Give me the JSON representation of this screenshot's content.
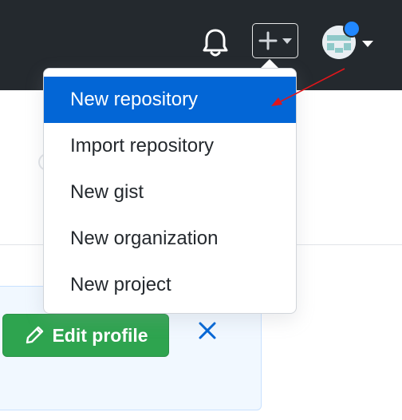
{
  "header": {
    "background": "#24292e",
    "icons": [
      "bell-icon",
      "plus-icon",
      "chevron-down-icon",
      "avatar"
    ]
  },
  "create_menu": {
    "items": [
      {
        "label": "New repository",
        "active": true
      },
      {
        "label": "Import repository"
      },
      {
        "label": "New gist"
      },
      {
        "label": "New organization"
      },
      {
        "label": "New project"
      }
    ],
    "active_color": "#0366d6"
  },
  "profile_card": {
    "edit_button": "Edit profile",
    "button_color": "#2ea44f",
    "close_icon": "close-icon"
  },
  "annotation": {
    "arrow_color": "#e0161b"
  }
}
